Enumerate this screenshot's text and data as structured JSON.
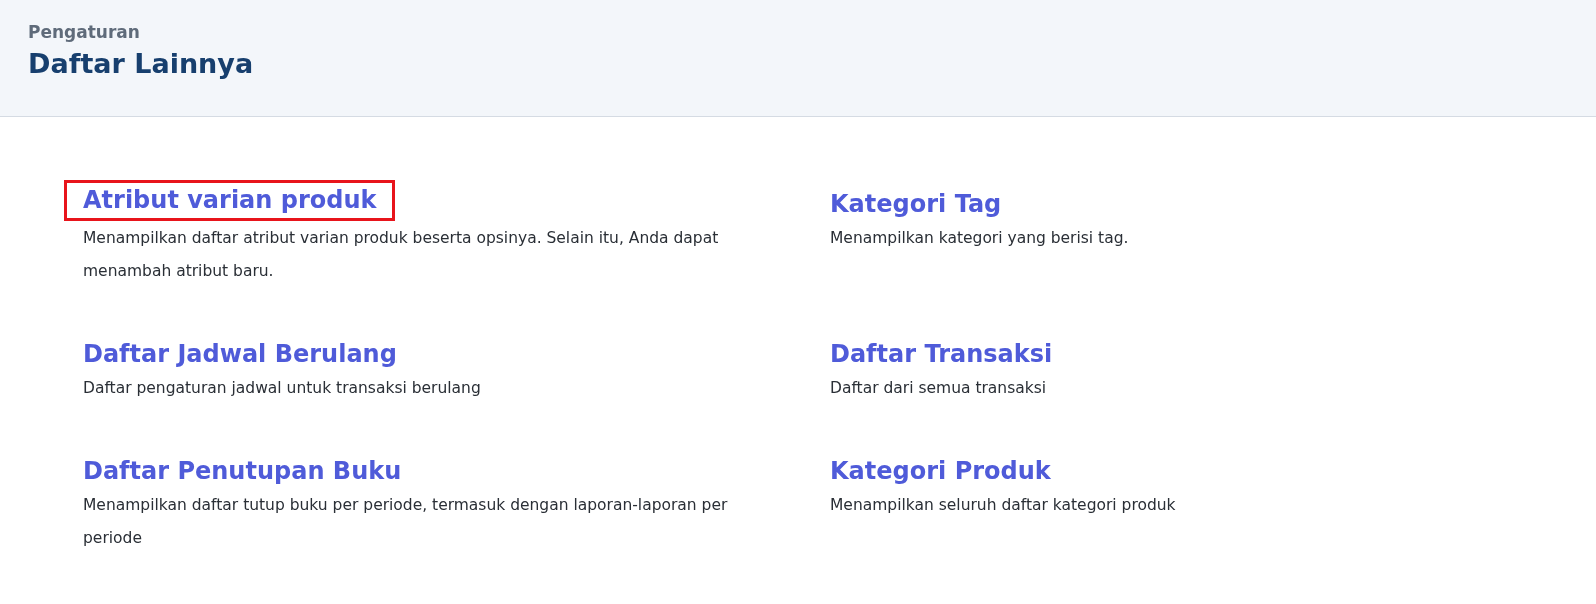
{
  "header": {
    "breadcrumb": "Pengaturan",
    "title": "Daftar Lainnya"
  },
  "items": [
    {
      "title": "Atribut varian produk",
      "description": "Menampilkan daftar atribut varian produk beserta opsinya. Selain itu, Anda dapat menambah atribut baru.",
      "highlighted": true
    },
    {
      "title": "Kategori Tag",
      "description": "Menampilkan kategori yang berisi tag.",
      "highlighted": false
    },
    {
      "title": "Daftar Jadwal Berulang",
      "description": "Daftar pengaturan jadwal untuk transaksi berulang",
      "highlighted": false
    },
    {
      "title": "Daftar Transaksi",
      "description": "Daftar dari semua transaksi",
      "highlighted": false
    },
    {
      "title": "Daftar Penutupan Buku",
      "description": "Menampilkan daftar tutup buku per periode, termasuk dengan laporan-laporan per periode",
      "highlighted": false
    },
    {
      "title": "Kategori Produk",
      "description": "Menampilkan seluruh daftar kategori produk",
      "highlighted": false
    }
  ]
}
